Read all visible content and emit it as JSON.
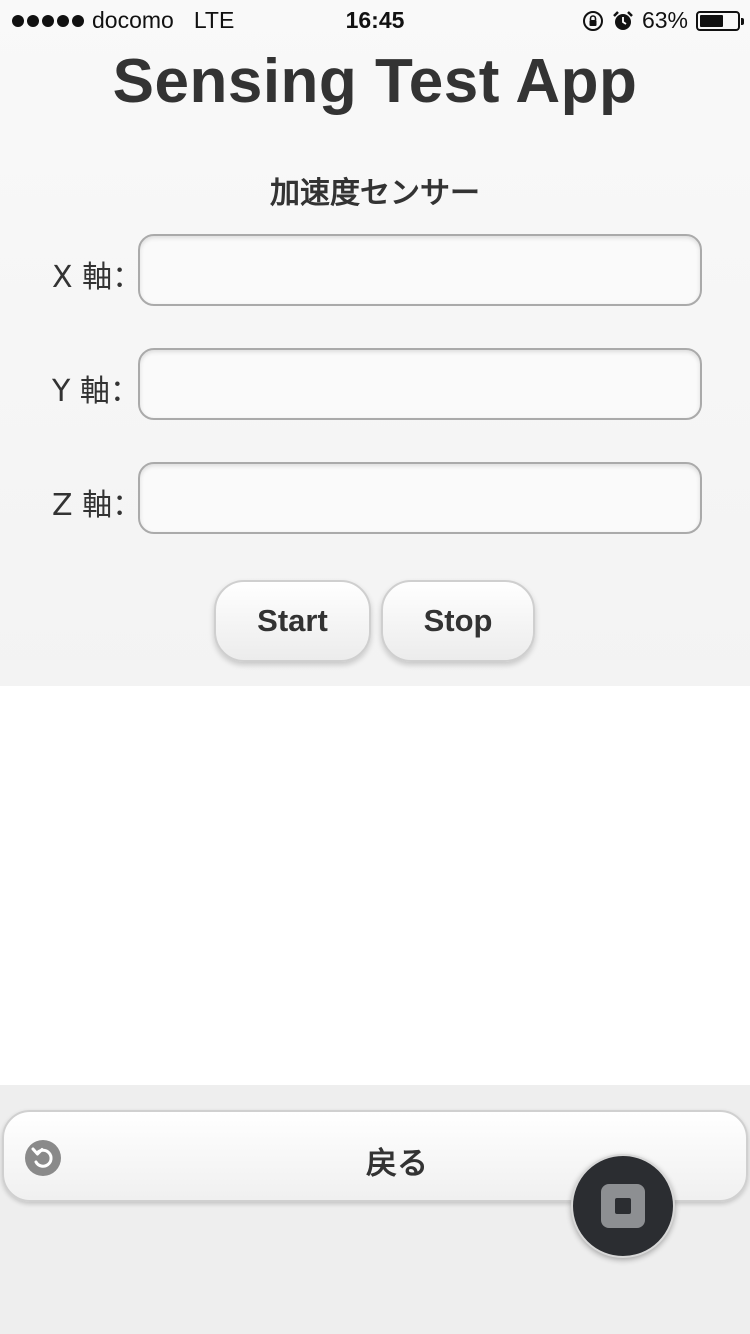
{
  "status_bar": {
    "carrier": "docomo",
    "network": "LTE",
    "time": "16:45",
    "battery": "63%",
    "battery_level": 0.63,
    "icons": [
      "rotation-lock-icon",
      "alarm-icon",
      "battery-icon"
    ]
  },
  "app": {
    "title": "Sensing Test App"
  },
  "sensor": {
    "section_title": "加速度センサー",
    "axes": [
      {
        "label": "X 軸：",
        "value": ""
      },
      {
        "label": "Y 軸：",
        "value": ""
      },
      {
        "label": "Z 軸：",
        "value": ""
      }
    ]
  },
  "buttons": {
    "start_label": "Start",
    "stop_label": "Stop"
  },
  "footer": {
    "back_label": "戻る",
    "back_icon": "back-arrow-icon",
    "floating_icon": "stop-square-icon"
  },
  "colors": {
    "panel_background": "#f6f6f6",
    "footer_background": "#eeeeee",
    "text": "#333333",
    "floating_button": "#2b2d31"
  }
}
